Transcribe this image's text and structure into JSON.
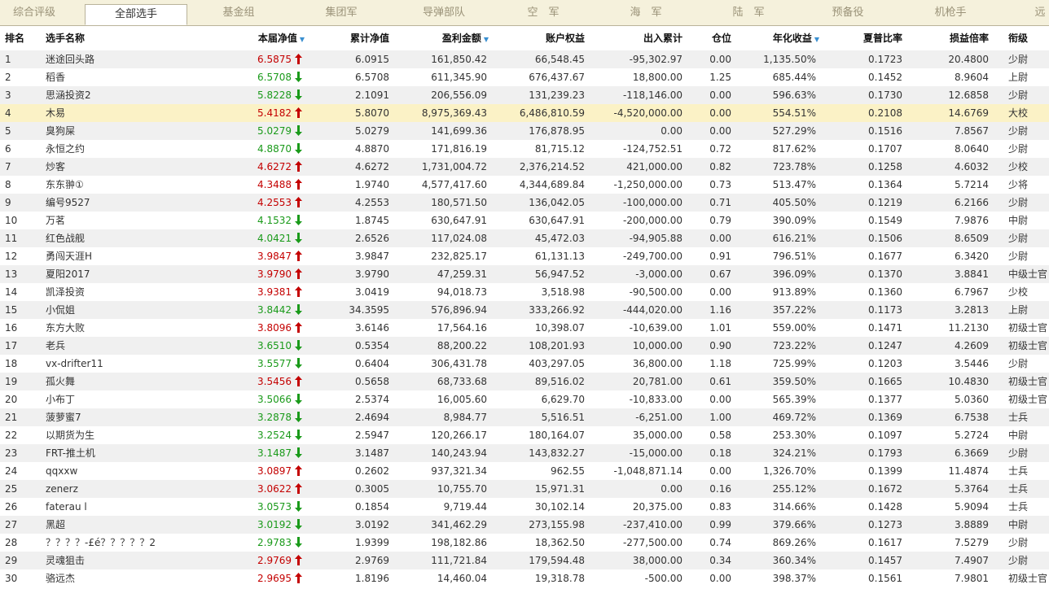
{
  "tabs": [
    "综合评级",
    "全部选手",
    "基金组",
    "集团军",
    "导弹部队",
    "空　军",
    "海　军",
    "陆　军",
    "预备役",
    "机枪手",
    "远"
  ],
  "active_tab": 1,
  "headers": {
    "rank": "排名",
    "name": "选手名称",
    "nav": "本届净值",
    "cum": "累计净值",
    "profit": "盈利金额",
    "equity": "账户权益",
    "flow": "出入累计",
    "pos": "仓位",
    "annual": "年化收益",
    "sharpe": "夏普比率",
    "pl_ratio": "损益倍率",
    "title": "衔级"
  },
  "sort_indicator": "▼",
  "colors": {
    "up": "#c40000",
    "down": "#1a9a1a",
    "highlight": "#fbf2c6",
    "alt_row": "#f0f0f0"
  },
  "rows": [
    {
      "rank": "1",
      "name": "迷途回头路",
      "nav": "6.5875",
      "dir": "up",
      "cum": "6.0915",
      "profit": "161,850.42",
      "equity": "66,548.45",
      "flow": "-95,302.97",
      "pos": "0.00",
      "annual": "1,135.50%",
      "sharpe": "0.1723",
      "pl": "20.4800",
      "title": "少尉"
    },
    {
      "rank": "2",
      "name": "稻香",
      "nav": "6.5708",
      "dir": "down",
      "cum": "6.5708",
      "profit": "611,345.90",
      "equity": "676,437.67",
      "flow": "18,800.00",
      "pos": "1.25",
      "annual": "685.44%",
      "sharpe": "0.1452",
      "pl": "8.9604",
      "title": "上尉"
    },
    {
      "rank": "3",
      "name": "思涵投资2",
      "nav": "5.8228",
      "dir": "down",
      "cum": "2.1091",
      "profit": "206,556.09",
      "equity": "131,239.23",
      "flow": "-118,146.00",
      "pos": "0.00",
      "annual": "596.63%",
      "sharpe": "0.1730",
      "pl": "12.6858",
      "title": "少尉"
    },
    {
      "rank": "4",
      "name": "木易",
      "nav": "5.4182",
      "dir": "up",
      "cum": "5.8070",
      "profit": "8,975,369.43",
      "equity": "6,486,810.59",
      "flow": "-4,520,000.00",
      "pos": "0.00",
      "annual": "554.51%",
      "sharpe": "0.2108",
      "pl": "14.6769",
      "title": "大校"
    },
    {
      "rank": "5",
      "name": "臭狗屎",
      "nav": "5.0279",
      "dir": "down",
      "cum": "5.0279",
      "profit": "141,699.36",
      "equity": "176,878.95",
      "flow": "0.00",
      "pos": "0.00",
      "annual": "527.29%",
      "sharpe": "0.1516",
      "pl": "7.8567",
      "title": "少尉"
    },
    {
      "rank": "6",
      "name": "永恒之约",
      "nav": "4.8870",
      "dir": "down",
      "cum": "4.8870",
      "profit": "171,816.19",
      "equity": "81,715.12",
      "flow": "-124,752.51",
      "pos": "0.72",
      "annual": "817.62%",
      "sharpe": "0.1707",
      "pl": "8.0640",
      "title": "少尉"
    },
    {
      "rank": "7",
      "name": "炒客",
      "nav": "4.6272",
      "dir": "up",
      "cum": "4.6272",
      "profit": "1,731,004.72",
      "equity": "2,376,214.52",
      "flow": "421,000.00",
      "pos": "0.82",
      "annual": "723.78%",
      "sharpe": "0.1258",
      "pl": "4.6032",
      "title": "少校"
    },
    {
      "rank": "8",
      "name": "东东翀①",
      "nav": "4.3488",
      "dir": "up",
      "cum": "1.9740",
      "profit": "4,577,417.60",
      "equity": "4,344,689.84",
      "flow": "-1,250,000.00",
      "pos": "0.73",
      "annual": "513.47%",
      "sharpe": "0.1364",
      "pl": "5.7214",
      "title": "少将"
    },
    {
      "rank": "9",
      "name": "编号9527",
      "nav": "4.2553",
      "dir": "up",
      "cum": "4.2553",
      "profit": "180,571.50",
      "equity": "136,042.05",
      "flow": "-100,000.00",
      "pos": "0.71",
      "annual": "405.50%",
      "sharpe": "0.1219",
      "pl": "6.2166",
      "title": "少尉"
    },
    {
      "rank": "10",
      "name": "万茗",
      "nav": "4.1532",
      "dir": "down",
      "cum": "1.8745",
      "profit": "630,647.91",
      "equity": "630,647.91",
      "flow": "-200,000.00",
      "pos": "0.79",
      "annual": "390.09%",
      "sharpe": "0.1549",
      "pl": "7.9876",
      "title": "中尉"
    },
    {
      "rank": "11",
      "name": "红色战舰",
      "nav": "4.0421",
      "dir": "down",
      "cum": "2.6526",
      "profit": "117,024.08",
      "equity": "45,472.03",
      "flow": "-94,905.88",
      "pos": "0.00",
      "annual": "616.21%",
      "sharpe": "0.1506",
      "pl": "8.6509",
      "title": "少尉"
    },
    {
      "rank": "12",
      "name": "勇闯天涯H",
      "nav": "3.9847",
      "dir": "up",
      "cum": "3.9847",
      "profit": "232,825.17",
      "equity": "61,131.13",
      "flow": "-249,700.00",
      "pos": "0.91",
      "annual": "796.51%",
      "sharpe": "0.1677",
      "pl": "6.3420",
      "title": "少尉"
    },
    {
      "rank": "13",
      "name": "夏阳2017",
      "nav": "3.9790",
      "dir": "up",
      "cum": "3.9790",
      "profit": "47,259.31",
      "equity": "56,947.52",
      "flow": "-3,000.00",
      "pos": "0.67",
      "annual": "396.09%",
      "sharpe": "0.1370",
      "pl": "3.8841",
      "title": "中级士官"
    },
    {
      "rank": "14",
      "name": "凯泽投资",
      "nav": "3.9381",
      "dir": "up",
      "cum": "3.0419",
      "profit": "94,018.73",
      "equity": "3,518.98",
      "flow": "-90,500.00",
      "pos": "0.00",
      "annual": "913.89%",
      "sharpe": "0.1360",
      "pl": "6.7967",
      "title": "少校"
    },
    {
      "rank": "15",
      "name": "小侃姐",
      "nav": "3.8442",
      "dir": "down",
      "cum": "34.3595",
      "profit": "576,896.94",
      "equity": "333,266.92",
      "flow": "-444,020.00",
      "pos": "1.16",
      "annual": "357.22%",
      "sharpe": "0.1173",
      "pl": "3.2813",
      "title": "上尉"
    },
    {
      "rank": "16",
      "name": "东方大败",
      "nav": "3.8096",
      "dir": "up",
      "cum": "3.6146",
      "profit": "17,564.16",
      "equity": "10,398.07",
      "flow": "-10,639.00",
      "pos": "1.01",
      "annual": "559.00%",
      "sharpe": "0.1471",
      "pl": "11.2130",
      "title": "初级士官"
    },
    {
      "rank": "17",
      "name": "老兵",
      "nav": "3.6510",
      "dir": "down",
      "cum": "0.5354",
      "profit": "88,200.22",
      "equity": "108,201.93",
      "flow": "10,000.00",
      "pos": "0.90",
      "annual": "723.22%",
      "sharpe": "0.1247",
      "pl": "4.2609",
      "title": "初级士官"
    },
    {
      "rank": "18",
      "name": "vx-drifter11",
      "nav": "3.5577",
      "dir": "down",
      "cum": "0.6404",
      "profit": "306,431.78",
      "equity": "403,297.05",
      "flow": "36,800.00",
      "pos": "1.18",
      "annual": "725.99%",
      "sharpe": "0.1203",
      "pl": "3.5446",
      "title": "少尉"
    },
    {
      "rank": "19",
      "name": "孤火舞",
      "nav": "3.5456",
      "dir": "up",
      "cum": "0.5658",
      "profit": "68,733.68",
      "equity": "89,516.02",
      "flow": "20,781.00",
      "pos": "0.61",
      "annual": "359.50%",
      "sharpe": "0.1665",
      "pl": "10.4830",
      "title": "初级士官"
    },
    {
      "rank": "20",
      "name": "小布丁",
      "nav": "3.5066",
      "dir": "down",
      "cum": "2.5374",
      "profit": "16,005.60",
      "equity": "6,629.70",
      "flow": "-10,833.00",
      "pos": "0.00",
      "annual": "565.39%",
      "sharpe": "0.1377",
      "pl": "5.0360",
      "title": "初级士官"
    },
    {
      "rank": "21",
      "name": "菠萝蜜7",
      "nav": "3.2878",
      "dir": "down",
      "cum": "2.4694",
      "profit": "8,984.77",
      "equity": "5,516.51",
      "flow": "-6,251.00",
      "pos": "1.00",
      "annual": "469.72%",
      "sharpe": "0.1369",
      "pl": "6.7538",
      "title": "士兵"
    },
    {
      "rank": "22",
      "name": "以期货为生",
      "nav": "3.2524",
      "dir": "down",
      "cum": "2.5947",
      "profit": "120,266.17",
      "equity": "180,164.07",
      "flow": "35,000.00",
      "pos": "0.58",
      "annual": "253.30%",
      "sharpe": "0.1097",
      "pl": "5.2724",
      "title": "中尉"
    },
    {
      "rank": "23",
      "name": "FRT-推土机",
      "nav": "3.1487",
      "dir": "down",
      "cum": "3.1487",
      "profit": "140,243.94",
      "equity": "143,832.27",
      "flow": "-15,000.00",
      "pos": "0.18",
      "annual": "324.21%",
      "sharpe": "0.1793",
      "pl": "6.3669",
      "title": "少尉"
    },
    {
      "rank": "24",
      "name": "qqxxw",
      "nav": "3.0897",
      "dir": "up",
      "cum": "0.2602",
      "profit": "937,321.34",
      "equity": "962.55",
      "flow": "-1,048,871.14",
      "pos": "0.00",
      "annual": "1,326.70%",
      "sharpe": "0.1399",
      "pl": "11.4874",
      "title": "士兵"
    },
    {
      "rank": "25",
      "name": "zenerz",
      "nav": "3.0622",
      "dir": "up",
      "cum": "0.3005",
      "profit": "10,755.70",
      "equity": "15,971.31",
      "flow": "0.00",
      "pos": "0.16",
      "annual": "255.12%",
      "sharpe": "0.1672",
      "pl": "5.3764",
      "title": "士兵"
    },
    {
      "rank": "26",
      "name": "faterau l",
      "nav": "3.0573",
      "dir": "down",
      "cum": "0.1854",
      "profit": "9,719.44",
      "equity": "30,102.14",
      "flow": "20,375.00",
      "pos": "0.83",
      "annual": "314.66%",
      "sharpe": "0.1428",
      "pl": "5.9094",
      "title": "士兵"
    },
    {
      "rank": "27",
      "name": "黑超",
      "nav": "3.0192",
      "dir": "down",
      "cum": "3.0192",
      "profit": "341,462.29",
      "equity": "273,155.98",
      "flow": "-237,410.00",
      "pos": "0.99",
      "annual": "379.66%",
      "sharpe": "0.1273",
      "pl": "3.8889",
      "title": "中尉"
    },
    {
      "rank": "28",
      "name": "？？？？-£é？？？？？2",
      "nav": "2.9783",
      "dir": "down",
      "cum": "1.9399",
      "profit": "198,182.86",
      "equity": "18,362.50",
      "flow": "-277,500.00",
      "pos": "0.74",
      "annual": "869.26%",
      "sharpe": "0.1617",
      "pl": "7.5279",
      "title": "少尉"
    },
    {
      "rank": "29",
      "name": "灵魂狙击",
      "nav": "2.9769",
      "dir": "up",
      "cum": "2.9769",
      "profit": "111,721.84",
      "equity": "179,594.48",
      "flow": "38,000.00",
      "pos": "0.34",
      "annual": "360.34%",
      "sharpe": "0.1457",
      "pl": "7.4907",
      "title": "少尉"
    },
    {
      "rank": "30",
      "name": "骆远杰",
      "nav": "2.9695",
      "dir": "up",
      "cum": "1.8196",
      "profit": "14,460.04",
      "equity": "19,318.78",
      "flow": "-500.00",
      "pos": "0.00",
      "annual": "398.37%",
      "sharpe": "0.1561",
      "pl": "7.9801",
      "title": "初级士官"
    }
  ]
}
